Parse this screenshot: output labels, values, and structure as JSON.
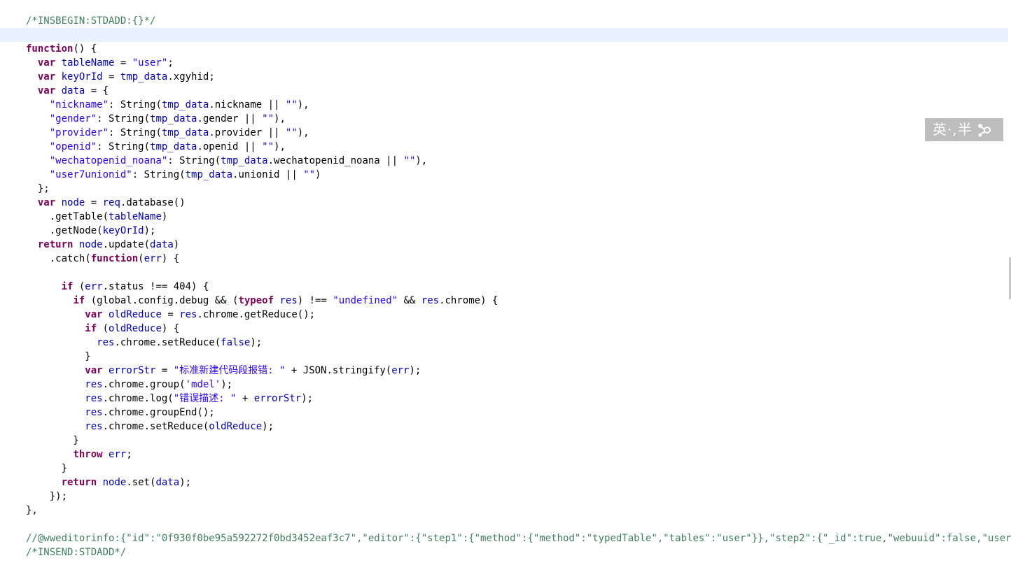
{
  "editor": {
    "lines": [
      [
        [
          "cm",
          "/*INSBEGIN:STDADD:{}*/"
        ]
      ],
      [],
      [
        [
          "kw",
          "function"
        ],
        [
          "pl",
          "() {"
        ]
      ],
      [
        [
          "pl",
          "  "
        ],
        [
          "kw",
          "var"
        ],
        [
          "pl",
          " "
        ],
        [
          "vr",
          "tableName"
        ],
        [
          "pl",
          " = "
        ],
        [
          "str",
          "\"user\""
        ],
        [
          "pl",
          ";"
        ]
      ],
      [
        [
          "pl",
          "  "
        ],
        [
          "kw",
          "var"
        ],
        [
          "pl",
          " "
        ],
        [
          "vr",
          "keyOrId"
        ],
        [
          "pl",
          " = "
        ],
        [
          "vr",
          "tmp_data"
        ],
        [
          "pl",
          ".xgyhid;"
        ]
      ],
      [
        [
          "pl",
          "  "
        ],
        [
          "kw",
          "var"
        ],
        [
          "pl",
          " "
        ],
        [
          "vr",
          "data"
        ],
        [
          "pl",
          " = {"
        ]
      ],
      [
        [
          "pl",
          "    "
        ],
        [
          "str",
          "\"nickname\""
        ],
        [
          "pl",
          ": String("
        ],
        [
          "vr",
          "tmp_data"
        ],
        [
          "pl",
          ".nickname || "
        ],
        [
          "str",
          "\"\""
        ],
        [
          "pl",
          "),"
        ]
      ],
      [
        [
          "pl",
          "    "
        ],
        [
          "str",
          "\"gender\""
        ],
        [
          "pl",
          ": String("
        ],
        [
          "vr",
          "tmp_data"
        ],
        [
          "pl",
          ".gender || "
        ],
        [
          "str",
          "\"\""
        ],
        [
          "pl",
          "),"
        ]
      ],
      [
        [
          "pl",
          "    "
        ],
        [
          "str",
          "\"provider\""
        ],
        [
          "pl",
          ": String("
        ],
        [
          "vr",
          "tmp_data"
        ],
        [
          "pl",
          ".provider || "
        ],
        [
          "str",
          "\"\""
        ],
        [
          "pl",
          "),"
        ]
      ],
      [
        [
          "pl",
          "    "
        ],
        [
          "str",
          "\"openid\""
        ],
        [
          "pl",
          ": String("
        ],
        [
          "vr",
          "tmp_data"
        ],
        [
          "pl",
          ".openid || "
        ],
        [
          "str",
          "\"\""
        ],
        [
          "pl",
          "),"
        ]
      ],
      [
        [
          "pl",
          "    "
        ],
        [
          "str",
          "\"wechatopenid_noana\""
        ],
        [
          "pl",
          ": String("
        ],
        [
          "vr",
          "tmp_data"
        ],
        [
          "pl",
          ".wechatopenid_noana || "
        ],
        [
          "str",
          "\"\""
        ],
        [
          "pl",
          "),"
        ]
      ],
      [
        [
          "pl",
          "    "
        ],
        [
          "str",
          "\"user7unionid\""
        ],
        [
          "pl",
          ": String("
        ],
        [
          "vr",
          "tmp_data"
        ],
        [
          "pl",
          ".unionid || "
        ],
        [
          "str",
          "\"\""
        ],
        [
          "pl",
          ")"
        ]
      ],
      [
        [
          "pl",
          "  };"
        ]
      ],
      [
        [
          "pl",
          "  "
        ],
        [
          "kw",
          "var"
        ],
        [
          "pl",
          " "
        ],
        [
          "vr",
          "node"
        ],
        [
          "pl",
          " = "
        ],
        [
          "vr",
          "req"
        ],
        [
          "pl",
          ".database()"
        ]
      ],
      [
        [
          "pl",
          "    .getTable("
        ],
        [
          "vr",
          "tableName"
        ],
        [
          "pl",
          ")"
        ]
      ],
      [
        [
          "pl",
          "    .getNode("
        ],
        [
          "vr",
          "keyOrId"
        ],
        [
          "pl",
          ");"
        ]
      ],
      [
        [
          "pl",
          "  "
        ],
        [
          "kw",
          "return"
        ],
        [
          "pl",
          " "
        ],
        [
          "vr",
          "node"
        ],
        [
          "pl",
          ".update("
        ],
        [
          "vr",
          "data"
        ],
        [
          "pl",
          ")"
        ]
      ],
      [
        [
          "pl",
          "    .catch("
        ],
        [
          "kw",
          "function"
        ],
        [
          "pl",
          "("
        ],
        [
          "vr",
          "err"
        ],
        [
          "pl",
          ") {"
        ]
      ],
      [],
      [
        [
          "pl",
          "      "
        ],
        [
          "kw",
          "if"
        ],
        [
          "pl",
          " ("
        ],
        [
          "vr",
          "err"
        ],
        [
          "pl",
          ".status !== "
        ],
        [
          "num",
          "404"
        ],
        [
          "pl",
          ") {"
        ]
      ],
      [
        [
          "pl",
          "        "
        ],
        [
          "kw",
          "if"
        ],
        [
          "pl",
          " (global.config.debug && ("
        ],
        [
          "kw",
          "typeof"
        ],
        [
          "pl",
          " "
        ],
        [
          "vr",
          "res"
        ],
        [
          "pl",
          ") !== "
        ],
        [
          "str",
          "\"undefined\""
        ],
        [
          "pl",
          " && "
        ],
        [
          "vr",
          "res"
        ],
        [
          "pl",
          ".chrome) {"
        ]
      ],
      [
        [
          "pl",
          "          "
        ],
        [
          "kw",
          "var"
        ],
        [
          "pl",
          " "
        ],
        [
          "vr",
          "oldReduce"
        ],
        [
          "pl",
          " = "
        ],
        [
          "vr",
          "res"
        ],
        [
          "pl",
          ".chrome.getReduce();"
        ]
      ],
      [
        [
          "pl",
          "          "
        ],
        [
          "kw",
          "if"
        ],
        [
          "pl",
          " ("
        ],
        [
          "vr",
          "oldReduce"
        ],
        [
          "pl",
          ") {"
        ]
      ],
      [
        [
          "pl",
          "            "
        ],
        [
          "vr",
          "res"
        ],
        [
          "pl",
          ".chrome.setReduce("
        ],
        [
          "vr",
          "false"
        ],
        [
          "pl",
          ");"
        ]
      ],
      [
        [
          "pl",
          "          }"
        ]
      ],
      [
        [
          "pl",
          "          "
        ],
        [
          "kw",
          "var"
        ],
        [
          "pl",
          " "
        ],
        [
          "vr",
          "errorStr"
        ],
        [
          "pl",
          " = "
        ],
        [
          "str",
          "\"标准新建代码段报错: \""
        ],
        [
          "pl",
          " + JSON.stringify("
        ],
        [
          "vr",
          "err"
        ],
        [
          "pl",
          ");"
        ]
      ],
      [
        [
          "pl",
          "          "
        ],
        [
          "vr",
          "res"
        ],
        [
          "pl",
          ".chrome.group("
        ],
        [
          "str",
          "'mdel'"
        ],
        [
          "pl",
          ");"
        ]
      ],
      [
        [
          "pl",
          "          "
        ],
        [
          "vr",
          "res"
        ],
        [
          "pl",
          ".chrome.log("
        ],
        [
          "str",
          "\"错误描述: \""
        ],
        [
          "pl",
          " + "
        ],
        [
          "vr",
          "errorStr"
        ],
        [
          "pl",
          ");"
        ]
      ],
      [
        [
          "pl",
          "          "
        ],
        [
          "vr",
          "res"
        ],
        [
          "pl",
          ".chrome.groupEnd();"
        ]
      ],
      [
        [
          "pl",
          "          "
        ],
        [
          "vr",
          "res"
        ],
        [
          "pl",
          ".chrome.setReduce("
        ],
        [
          "vr",
          "oldReduce"
        ],
        [
          "pl",
          ");"
        ]
      ],
      [
        [
          "pl",
          "        }"
        ]
      ],
      [
        [
          "pl",
          "        "
        ],
        [
          "kw",
          "throw"
        ],
        [
          "pl",
          " "
        ],
        [
          "vr",
          "err"
        ],
        [
          "pl",
          ";"
        ]
      ],
      [
        [
          "pl",
          "      }"
        ]
      ],
      [
        [
          "pl",
          "      "
        ],
        [
          "kw",
          "return"
        ],
        [
          "pl",
          " "
        ],
        [
          "vr",
          "node"
        ],
        [
          "pl",
          ".set("
        ],
        [
          "vr",
          "data"
        ],
        [
          "pl",
          ");"
        ]
      ],
      [
        [
          "pl",
          "    });"
        ]
      ],
      [
        [
          "pl",
          "},"
        ]
      ],
      [],
      [
        [
          "cm",
          "//@wweditorinfo:{\"id\":\"0f930f0be95a592272f0bd3452eaf3c7\",\"editor\":{\"step1\":{\"method\":{\"method\":\"typedTable\",\"tables\":\"user\"}},\"step2\":{\"_id\":true,\"webuuid\":false,\"user"
        ]
      ],
      [
        [
          "cm",
          "/*INSEND:STDADD*/"
        ]
      ]
    ],
    "current_line": 1
  },
  "ime": {
    "text": "英·,半"
  },
  "colors": {
    "keyword": "#7f0055",
    "string": "#2a00ff",
    "variable": "#0000c0",
    "comment": "#3f7f5f",
    "current_line_bg": "#e8f2fe"
  }
}
